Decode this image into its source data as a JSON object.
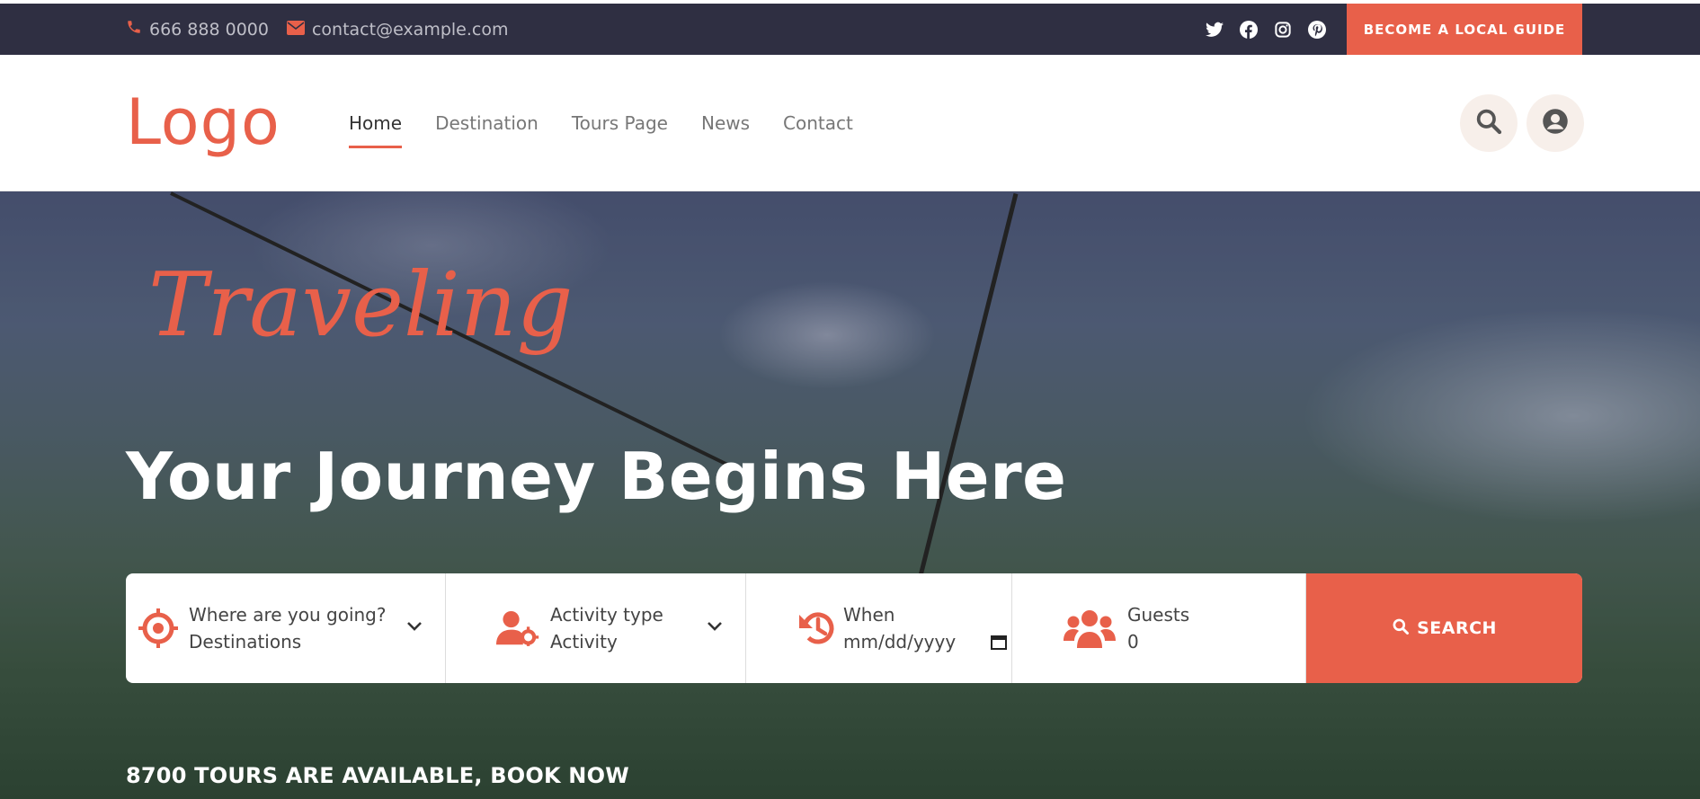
{
  "topbar": {
    "phone": "666 888 0000",
    "email": "contact@example.com",
    "social": [
      "twitter-icon",
      "facebook-icon",
      "instagram-icon",
      "pinterest-icon"
    ],
    "guide_button": "BECOME A LOCAL GUIDE"
  },
  "header": {
    "logo": "Logo",
    "nav": [
      {
        "label": "Home",
        "active": true
      },
      {
        "label": "Destination",
        "active": false
      },
      {
        "label": "Tours Page",
        "active": false
      },
      {
        "label": "News",
        "active": false
      },
      {
        "label": "Contact",
        "active": false
      }
    ]
  },
  "hero": {
    "tagline": "Traveling",
    "headline": "Your Journey Begins Here",
    "tours_text": "8700 TOURS ARE AVAILABLE, BOOK NOW"
  },
  "search": {
    "destination": {
      "label": "Where are you going?",
      "value": "Destinations"
    },
    "activity": {
      "label": "Activity type",
      "value": "Activity"
    },
    "when": {
      "label": "When",
      "placeholder": "mm/dd/yyyy"
    },
    "guests": {
      "label": "Guests",
      "value": "0"
    },
    "button": "SEARCH"
  },
  "colors": {
    "accent": "#e8604a",
    "topbar": "#2f2f42"
  }
}
